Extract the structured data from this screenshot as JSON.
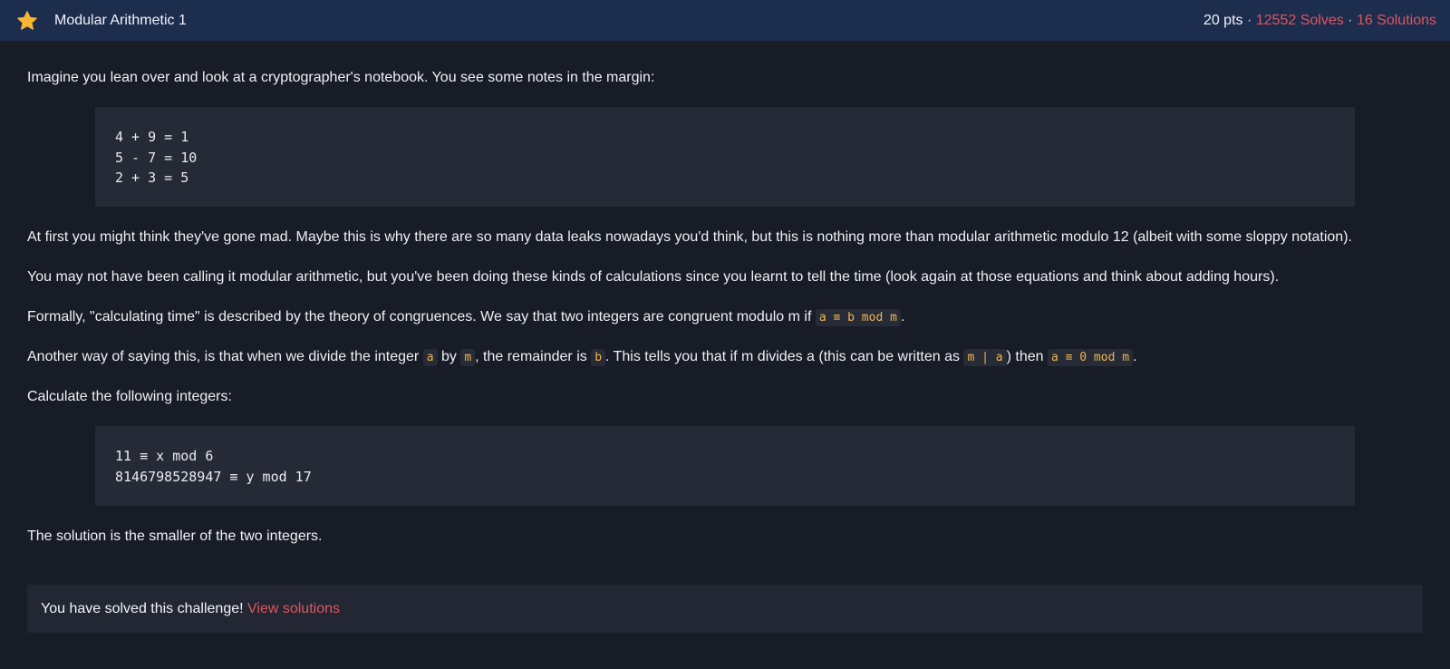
{
  "header": {
    "title": "Modular Arithmetic 1",
    "points": "20 pts",
    "sep1": " · ",
    "solves": "12552 Solves",
    "sep2": " · ",
    "solutions": "16 Solutions",
    "star_icon": "star-icon",
    "star_color": "#f7b733"
  },
  "body": {
    "intro": "Imagine you lean over and look at a cryptographer's notebook. You see some notes in the margin:",
    "code1": [
      "4 + 9 = 1",
      "5 - 7 = 10",
      "2 + 3 = 5"
    ],
    "p1": "At first you might think they've gone mad. Maybe this is why there are so many data leaks nowadays you'd think, but this is nothing more than modular arithmetic modulo 12 (albeit with some sloppy notation).",
    "p2": "You may not have been calling it modular arithmetic, but you've been doing these kinds of calculations since you learnt to tell the time (look again at those equations and think about adding hours).",
    "p3_text": "Formally, \"calculating time\" is described by the theory of congruences. We say that two integers are congruent modulo m if ",
    "p3_code": "a ≡ b mod m",
    "p3_end": ".",
    "p4_a": "Another way of saying this, is that when we divide the integer ",
    "p4_code_a": "a",
    "p4_b": " by ",
    "p4_code_m": "m",
    "p4_c": ", the remainder is ",
    "p4_code_b": "b",
    "p4_d": ". This tells you that if m divides a (this can be written as ",
    "p4_code_div": "m | a",
    "p4_e": ") then ",
    "p4_code_zero": "a ≡ 0 mod m",
    "p4_f": ".",
    "p5": "Calculate the following integers:",
    "code2": [
      "11 ≡ x mod 6",
      "8146798528947 ≡ y mod 17"
    ],
    "p6": "The solution is the smaller of the two integers."
  },
  "solved": {
    "text": "You have solved this challenge! ",
    "link": "View solutions"
  }
}
